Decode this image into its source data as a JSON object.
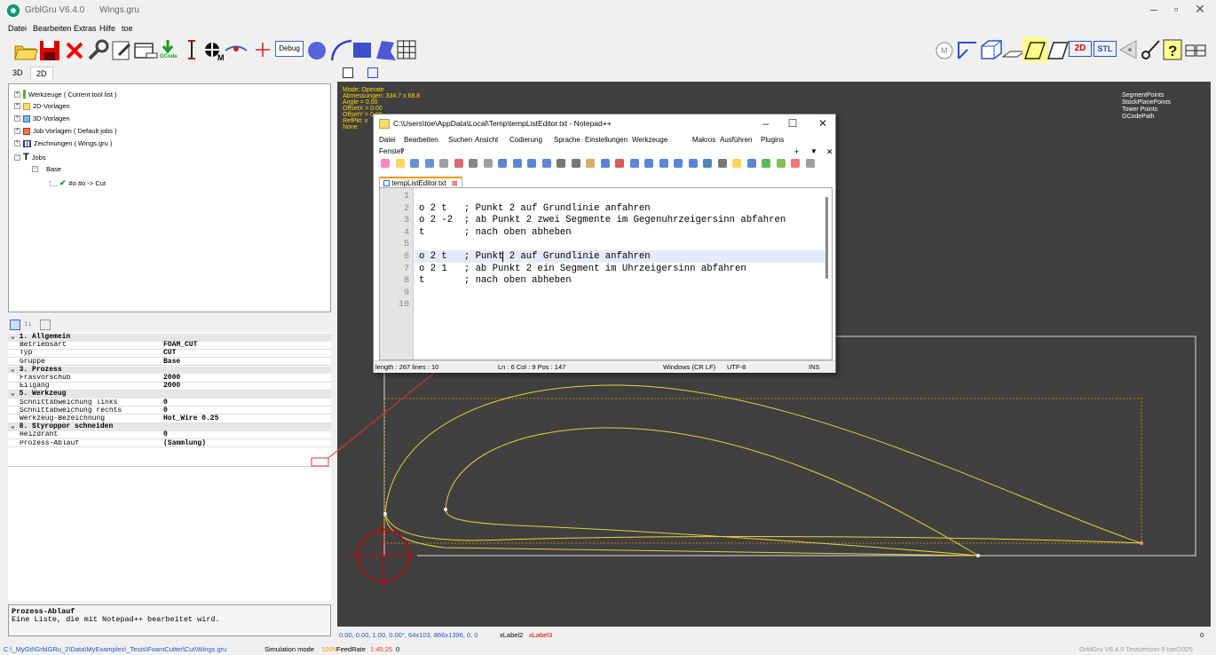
{
  "app": {
    "title": "GrblGru V6.4.0",
    "file": "Wings.gru"
  },
  "menu": [
    "Datei",
    "Bearbeiten",
    "Extras",
    "Hilfe",
    "toe"
  ],
  "toolbar": {
    "gcode_label": "GCode",
    "debug_label": "Debug",
    "btn_2d": "2D",
    "btn_stl": "STL",
    "btn_m": "M"
  },
  "left_tabs": [
    "3D",
    "2D"
  ],
  "tree": [
    {
      "label": "Werkzeuge  ( Current tool list )"
    },
    {
      "label": "2D-Vorlagen"
    },
    {
      "label": "3D-Vorlagen"
    },
    {
      "label": "Job Vorlagen  ( Default jobs )"
    },
    {
      "label": "Zeichnungen  ( Wings.gru )"
    },
    {
      "label": "Jobs"
    },
    {
      "label": "Base"
    },
    {
      "label": "#o #o  -> Cut"
    }
  ],
  "properties": [
    {
      "type": "cat",
      "label": "1. Allgemein"
    },
    {
      "type": "prop",
      "key": "Betriebsart",
      "value": "FOAM_CUT"
    },
    {
      "type": "prop",
      "key": "Typ",
      "value": "CUT"
    },
    {
      "type": "prop",
      "key": "Gruppe",
      "value": "Base"
    },
    {
      "type": "cat",
      "label": "3. Prozess"
    },
    {
      "type": "prop",
      "key": "Fräsvorschub",
      "value": "2000"
    },
    {
      "type": "prop",
      "key": "Eilgang",
      "value": "2000"
    },
    {
      "type": "cat",
      "label": "5. Werkzeug"
    },
    {
      "type": "prop",
      "key": "Schnittabweichung links",
      "value": "0"
    },
    {
      "type": "prop",
      "key": "Schnittabweichung rechts",
      "value": "0"
    },
    {
      "type": "prop",
      "key": "Werkzeug-Bezeichnung",
      "value": "Hot_Wire 0.25"
    },
    {
      "type": "cat",
      "label": "8. Styroppor schneiden"
    },
    {
      "type": "prop",
      "key": "Heizdraht",
      "value": "0"
    },
    {
      "type": "prop",
      "key": "Prozess-Ablauf",
      "value": "(Sammlung)"
    }
  ],
  "description": {
    "title": "Prozess-Ablauf",
    "text": "Eine Liste, die mit Notepad++ bearbeitet wird."
  },
  "info_overlay": [
    "Mode: Operate",
    "Abmessungen:  334.7 x 68.8",
    "Angle = 0.00",
    "OffsetX = 0.00",
    "OffsetY = 0.00",
    "RefPkt: x",
    "None"
  ],
  "legend": [
    "SegmentPoints",
    "StockPlanePoints",
    "Tower Points",
    "GCodePath"
  ],
  "view_status": {
    "coords": "0.00, 0.00, 1.00,  0.00°,   64x103,   866x1396,   0, 0",
    "label2": "xLabel2",
    "label3": "xLabel3",
    "right": "0"
  },
  "status": {
    "path": "C:\\_MyGit\\GrblGRu_2\\Data\\MyExamples\\_Tests\\FoamCutter\\Cut\\Wings.gru",
    "mode": "Simulation mode",
    "percent": "100%",
    "feed_label": "FeedRate",
    "time": "1:45:25",
    "zero": "0",
    "version": "GrblGru V6.4.0  Testversion 5 toe/2025"
  },
  "notepad": {
    "title": "C:\\Users\\toe\\AppData\\Local\\Temp\\tempListEditor.txt - Notepad++",
    "menu": [
      "Datei",
      "Bearbeiten",
      "Suchen",
      "Ansicht",
      "Codierung",
      "Sprache",
      "Einstellungen",
      "Werkzeuge",
      "Makros",
      "Ausführen",
      "Plugins",
      "Fenster",
      "?"
    ],
    "tab": "tempListEditor.txt",
    "lines": [
      "",
      "o 2 t   ; Punkt 2 auf Grundlinie anfahren",
      "o 2 -2  ; ab Punkt 2 zwei Segmente im Gegenuhrzeigersinn abfahren",
      "t       ; nach oben abheben",
      "",
      "o 2 t   ; Punkt 2 auf Grundlinie anfahren",
      "o 2 1   ; ab Punkt 2 ein Segment im Uhrzeigersinn abfahren",
      "t       ; nach oben abheben",
      "",
      ""
    ],
    "status": {
      "length": "length : 267   lines : 10",
      "pos": "Ln : 6   Col : 9   Pos : 147",
      "eol": "Windows (CR LF)",
      "enc": "UTF-8",
      "ins": "INS"
    }
  }
}
